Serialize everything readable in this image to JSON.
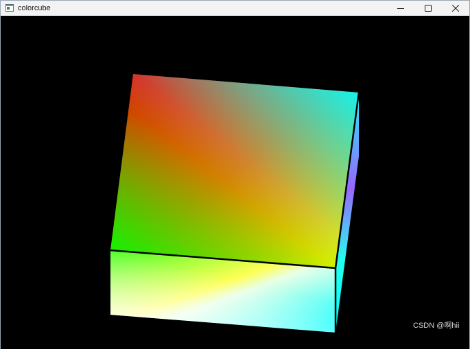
{
  "window": {
    "title": "colorcube",
    "app_icon": "window-app-icon",
    "controls": {
      "minimize_icon": "minimize-icon",
      "maximize_icon": "maximize-icon",
      "close_icon": "close-icon"
    }
  },
  "canvas": {
    "background": "#000000",
    "cube_colors": {
      "red": "#ff0000",
      "green": "#00ff00",
      "yellow": "#ffff00",
      "cyan": "#00ffff",
      "white": "#ffffff",
      "magenta": "#ff00ff",
      "edge": "#000000"
    }
  },
  "watermark": {
    "text": "CSDN @啊hii"
  }
}
